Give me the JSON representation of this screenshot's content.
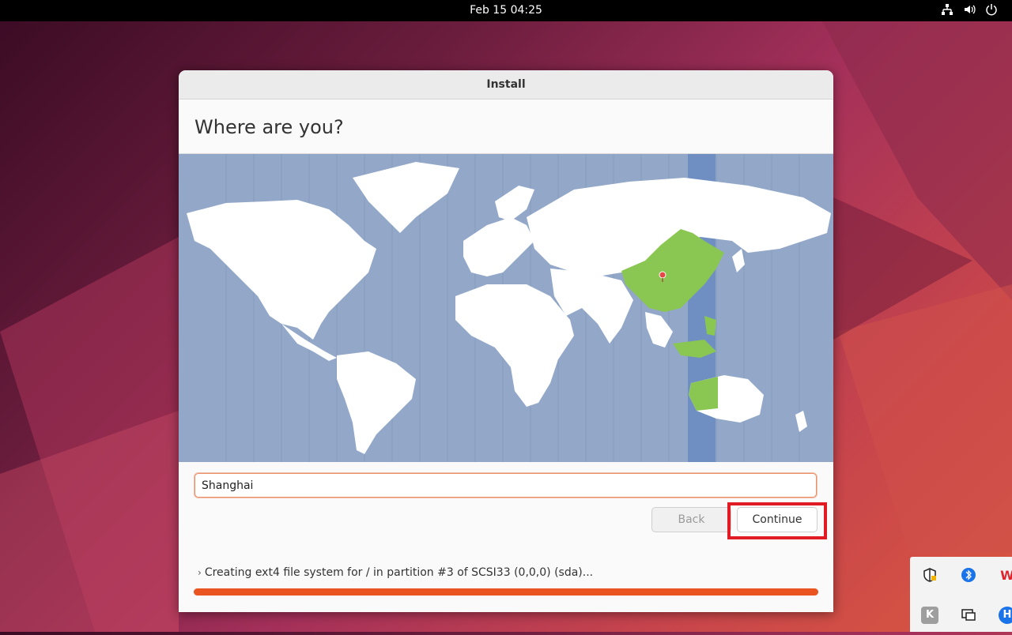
{
  "topbar": {
    "clock": "Feb 15  04:25",
    "icons": [
      "network-icon",
      "volume-icon",
      "power-icon"
    ]
  },
  "window": {
    "title": "Install",
    "heading": "Where are you?",
    "location_value": "Shanghai",
    "back_label": "Back",
    "continue_label": "Continue",
    "status_text": "Creating ext4 file system for / in partition #3 of SCSI33 (0,0,0) (sda)...",
    "progress": 1.0
  },
  "colors": {
    "accent": "#e95420",
    "map_ocean": "#93a8c9",
    "selected_region": "#8ac652",
    "highlight": "#e01b24"
  }
}
